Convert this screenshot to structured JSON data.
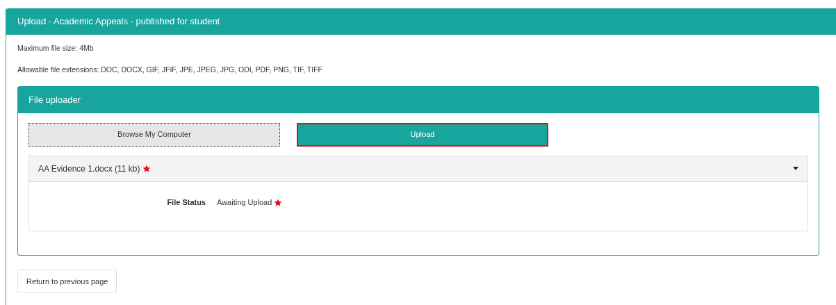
{
  "panel": {
    "title": "Upload - Academic Appeals - published for student"
  },
  "info": [
    "Maximum file size: 4Mb",
    "Allowable file extensions: DOC, DOCX, GIF, JFIF, JPE, JPEG, JPG, ODI, PDF, PNG, TIF, TIFF"
  ],
  "uploader": {
    "title": "File uploader",
    "buttons": [
      {
        "label": "Browse My Computer",
        "kind": "browse",
        "focused": false
      },
      {
        "label": "Upload",
        "kind": "upload",
        "focused": true
      }
    ],
    "files": [
      {
        "name": "AA Evidence 1.docx (11 kb)",
        "expanded": true,
        "details": [
          {
            "label": "File Status",
            "value": "Awaiting Upload"
          }
        ]
      }
    ]
  },
  "return_button": "Return to previous page"
}
